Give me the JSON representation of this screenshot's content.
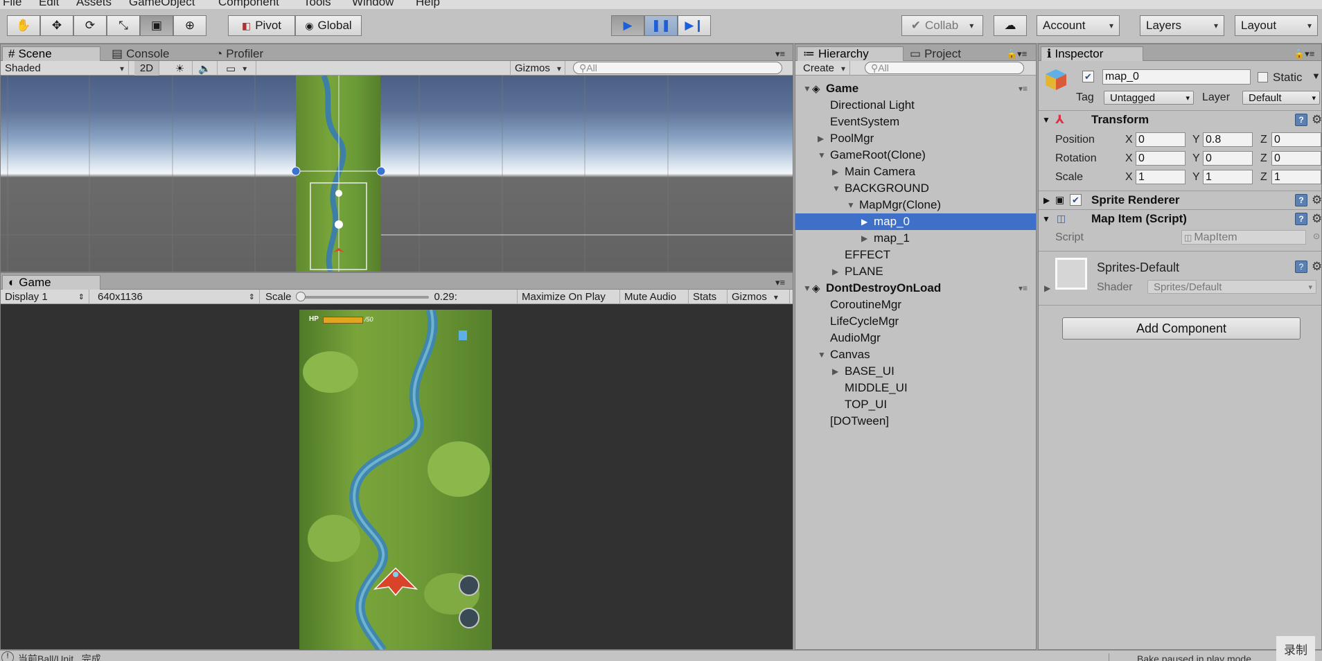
{
  "menu": [
    "File",
    "Edit",
    "Assets",
    "GameObject",
    "Component",
    "Tools",
    "Window",
    "Help"
  ],
  "toolbar": {
    "pivot": "Pivot",
    "global": "Global",
    "collab": "Collab",
    "account": "Account",
    "layers": "Layers",
    "layout": "Layout"
  },
  "scene": {
    "tabs": [
      "Scene",
      "Console",
      "Profiler"
    ],
    "shading": "Shaded",
    "mode2d": "2D",
    "gizmos": "Gizmos",
    "search_placeholder": "All"
  },
  "game": {
    "tab": "Game",
    "display": "Display 1",
    "resolution": "640x1136",
    "scale_label": "Scale",
    "scale_value": "0.29:",
    "maximize": "Maximize On Play",
    "mute": "Mute Audio",
    "stats": "Stats",
    "gizmos": "Gizmos",
    "hp_label": "HP",
    "hp_value": "/50"
  },
  "hierarchy": {
    "tabs": [
      "Hierarchy",
      "Project"
    ],
    "create": "Create",
    "search_placeholder": "All",
    "rows": [
      {
        "label": "Game",
        "depth": 0,
        "arrow": "▼",
        "scene": true
      },
      {
        "label": "Directional Light",
        "depth": 1,
        "arrow": ""
      },
      {
        "label": "EventSystem",
        "depth": 1,
        "arrow": ""
      },
      {
        "label": "PoolMgr",
        "depth": 1,
        "arrow": "▶"
      },
      {
        "label": "GameRoot(Clone)",
        "depth": 1,
        "arrow": "▼"
      },
      {
        "label": "Main Camera",
        "depth": 2,
        "arrow": "▶"
      },
      {
        "label": "BACKGROUND",
        "depth": 2,
        "arrow": "▼"
      },
      {
        "label": "MapMgr(Clone)",
        "depth": 3,
        "arrow": "▼"
      },
      {
        "label": "map_0",
        "depth": 4,
        "arrow": "▶",
        "selected": true
      },
      {
        "label": "map_1",
        "depth": 4,
        "arrow": "▶"
      },
      {
        "label": "EFFECT",
        "depth": 2,
        "arrow": ""
      },
      {
        "label": "PLANE",
        "depth": 2,
        "arrow": "▶"
      },
      {
        "label": "DontDestroyOnLoad",
        "depth": 0,
        "arrow": "▼",
        "scene": true
      },
      {
        "label": "CoroutineMgr",
        "depth": 1,
        "arrow": ""
      },
      {
        "label": "LifeCycleMgr",
        "depth": 1,
        "arrow": ""
      },
      {
        "label": "AudioMgr",
        "depth": 1,
        "arrow": ""
      },
      {
        "label": "Canvas",
        "depth": 1,
        "arrow": "▼"
      },
      {
        "label": "BASE_UI",
        "depth": 2,
        "arrow": "▶"
      },
      {
        "label": "MIDDLE_UI",
        "depth": 2,
        "arrow": ""
      },
      {
        "label": "TOP_UI",
        "depth": 2,
        "arrow": ""
      },
      {
        "label": "[DOTween]",
        "depth": 1,
        "arrow": ""
      }
    ]
  },
  "inspector": {
    "tab": "Inspector",
    "name": "map_0",
    "static": "Static",
    "tag_label": "Tag",
    "tag": "Untagged",
    "layer_label": "Layer",
    "layer": "Default",
    "transform": {
      "title": "Transform",
      "position": {
        "label": "Position",
        "x": "0",
        "y": "0.8",
        "z": "0"
      },
      "rotation": {
        "label": "Rotation",
        "x": "0",
        "y": "0",
        "z": "0"
      },
      "scale": {
        "label": "Scale",
        "x": "1",
        "y": "1",
        "z": "1"
      }
    },
    "sprite_renderer": "Sprite Renderer",
    "map_item": "Map Item (Script)",
    "script_label": "Script",
    "script": "MapItem",
    "material": "Sprites-Default",
    "shader_label": "Shader",
    "shader": "Sprites/Default",
    "add_component": "Add Component"
  },
  "status": {
    "message": "当前Ball/Unit...完成",
    "bake": "Bake paused in play mode",
    "record": "录制"
  },
  "axes": {
    "x": "X",
    "y": "Y",
    "z": "Z"
  }
}
